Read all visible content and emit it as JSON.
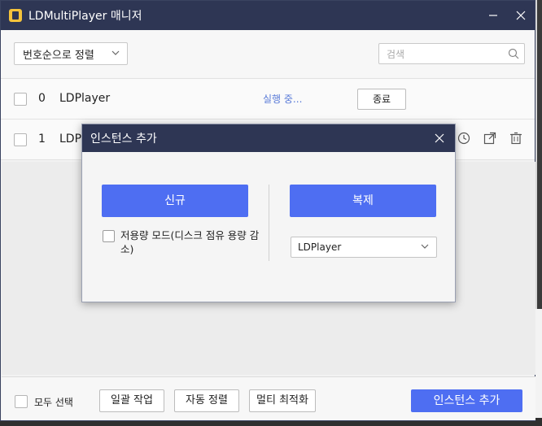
{
  "window": {
    "title": "LDMultiPlayer 매니저",
    "minimize_icon": "minimize-icon",
    "close_icon": "close-icon"
  },
  "toolbar": {
    "sort_value": "번호순으로 정렬",
    "search_placeholder": "검색"
  },
  "instances": [
    {
      "index": "0",
      "name": "LDPlayer",
      "status": "실행 중...",
      "action": "종료"
    },
    {
      "index": "1",
      "name": "LDP"
    }
  ],
  "footer": {
    "select_all": "모두 선택",
    "batch": "일괄 작업",
    "auto_sort": "자동 정렬",
    "multi_optimize": "멀티 최적화",
    "add_instance": "인스턴스 추가"
  },
  "dialog": {
    "title": "인스턴스 추가",
    "new_label": "신규",
    "copy_label": "복제",
    "low_storage_label": "저용량 모드(디스크 점유 용량 감소)",
    "source_value": "LDPlayer"
  },
  "colors": {
    "titlebar": "#2e3654",
    "primary": "#4e6ef2",
    "status": "#5a7bd8"
  }
}
